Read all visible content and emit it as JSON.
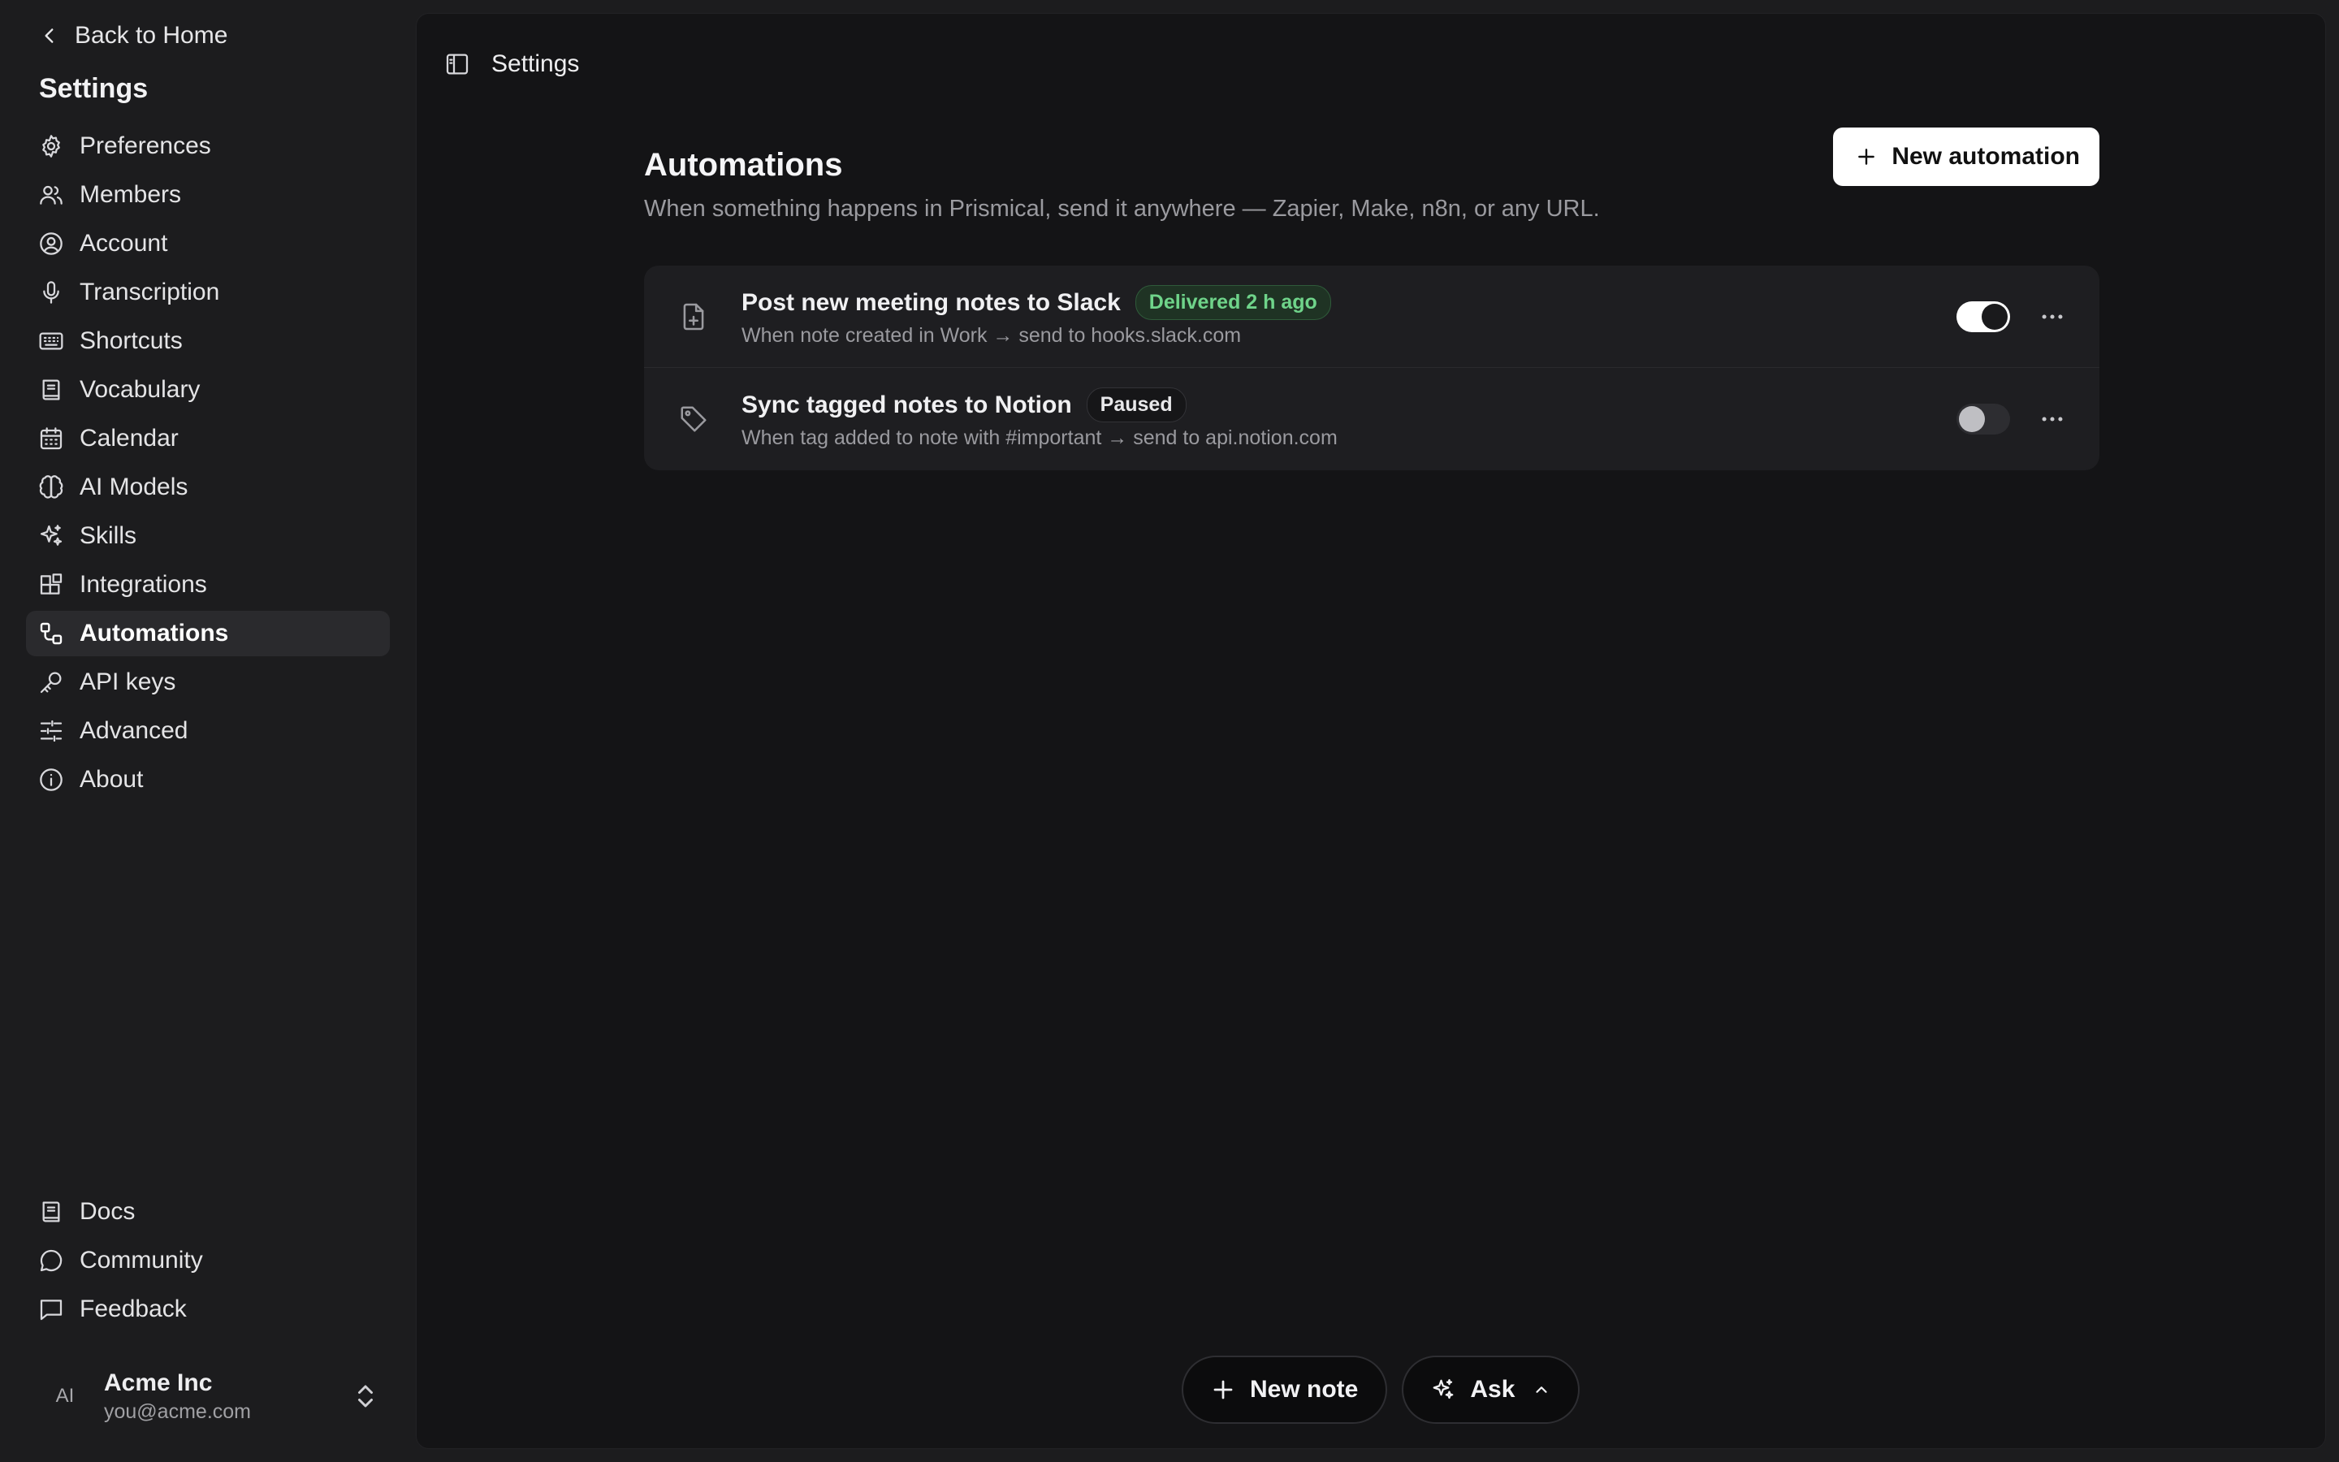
{
  "sidebar": {
    "back_label": "Back to Home",
    "title": "Settings",
    "items": [
      {
        "label": "Preferences",
        "icon": "gear-icon"
      },
      {
        "label": "Members",
        "icon": "users-icon"
      },
      {
        "label": "Account",
        "icon": "user-circle-icon"
      },
      {
        "label": "Transcription",
        "icon": "microphone-icon"
      },
      {
        "label": "Shortcuts",
        "icon": "keyboard-icon"
      },
      {
        "label": "Vocabulary",
        "icon": "book-icon"
      },
      {
        "label": "Calendar",
        "icon": "calendar-icon"
      },
      {
        "label": "AI Models",
        "icon": "brain-icon"
      },
      {
        "label": "Skills",
        "icon": "sparkles-icon"
      },
      {
        "label": "Integrations",
        "icon": "blocks-icon"
      },
      {
        "label": "Automations",
        "icon": "workflow-icon",
        "active": true
      },
      {
        "label": "API keys",
        "icon": "key-icon"
      },
      {
        "label": "Advanced",
        "icon": "sliders-icon"
      },
      {
        "label": "About",
        "icon": "info-icon"
      }
    ],
    "bottom_items": [
      {
        "label": "Docs",
        "icon": "book-icon"
      },
      {
        "label": "Community",
        "icon": "chat-bubble-icon"
      },
      {
        "label": "Feedback",
        "icon": "message-square-icon"
      }
    ],
    "account": {
      "initials": "AI",
      "name": "Acme Inc",
      "email": "you@acme.com"
    }
  },
  "header": {
    "title": "Settings"
  },
  "main": {
    "title": "Automations",
    "subtitle": "When something happens in Prismical, send it anywhere — Zapier, Make, n8n, or any URL.",
    "new_button_label": "New automation",
    "automations": [
      {
        "title": "Post new meeting notes to Slack",
        "badge": "Delivered 2 h ago",
        "badge_color": "#6fd48a",
        "description": "When note created in Work → send to hooks.slack.com",
        "enabled": true,
        "icon": "file-plus-icon"
      },
      {
        "title": "Sync tagged notes to Notion",
        "badge": "Paused",
        "badge_color": "#e8e8ea",
        "description": "When tag added to note with #important → send to api.notion.com",
        "enabled": false,
        "icon": "tag-icon"
      }
    ]
  },
  "bottom_bar": {
    "new_note_label": "New note",
    "ask_label": "Ask"
  },
  "colors": {
    "background": "#1c1c1e",
    "panel": "#141416",
    "card": "#1e1e21",
    "accent_green": "#6fd48a"
  }
}
